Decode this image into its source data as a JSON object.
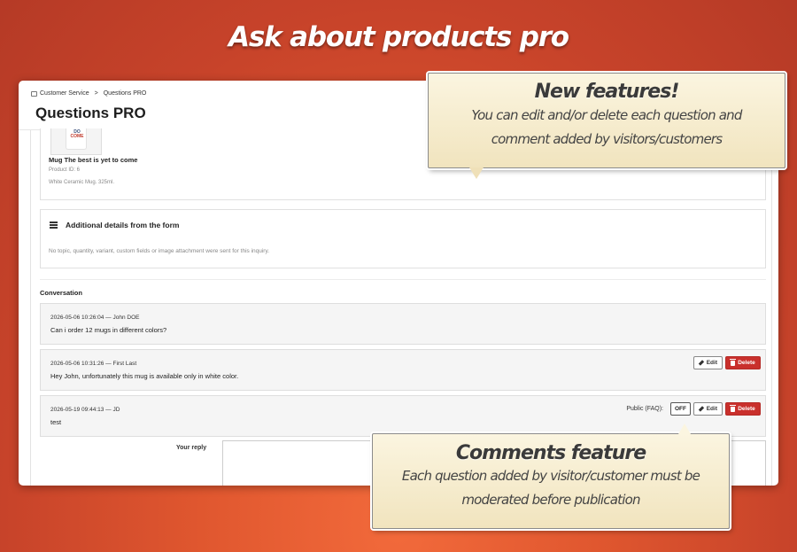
{
  "hero": {
    "title": "Ask about products pro"
  },
  "breadcrumb": {
    "section": "Customer Service",
    "separator": ">",
    "current": "Questions PRO"
  },
  "page": {
    "title": "Questions PRO"
  },
  "product": {
    "mug_line1": "DO",
    "mug_line2": "COME",
    "name": "Mug The best is yet to come",
    "id_text": "Product ID: 6",
    "description": "White Ceramic Mug. 325ml."
  },
  "details": {
    "icon": "list-icon",
    "title": "Additional details from the form",
    "note": "No topic, quantity, variant, custom fields or image attachment were sent for this inquiry."
  },
  "conversation": {
    "title": "Conversation",
    "messages": [
      {
        "meta": "2026-05-06 10:26:04 — John DOE",
        "text": "Can i order 12 mugs in different colors?"
      },
      {
        "meta": "2026-05-06 10:31:26 — First Last",
        "text": "Hey John, unfortunately this mug is available only in white color.",
        "edit_label": "Edit",
        "delete_label": "Delete"
      },
      {
        "meta": "2026-05-19 09:44:13 — JD",
        "text": "test",
        "faq_label": "Public (FAQ):",
        "toggle_label": "OFF",
        "edit_label": "Edit",
        "delete_label": "Delete"
      }
    ]
  },
  "reply": {
    "label": "Your reply"
  },
  "callouts": {
    "new_features": {
      "title": "New features!",
      "line1": "You can edit and/or delete each question and",
      "line2": "comment added by visitors/customers"
    },
    "comments": {
      "title": "Comments feature",
      "line1": "Each question added by visitor/customer must be",
      "line2": "moderated before publication"
    }
  },
  "colors": {
    "background": "#e0572f",
    "delete": "#c9302c",
    "callout": "#f1e4be"
  }
}
